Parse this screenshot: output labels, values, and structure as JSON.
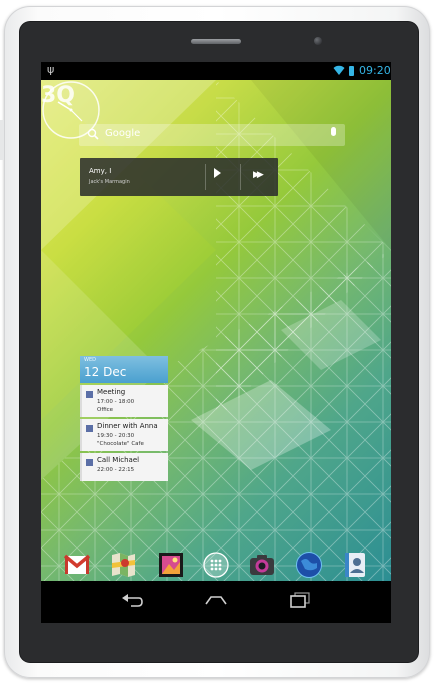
{
  "status_bar": {
    "time": "09:20",
    "icons": [
      "usb-icon",
      "wifi-icon",
      "battery-icon"
    ],
    "accent": "#35b5e5"
  },
  "search_widget": {
    "label": "Google",
    "icons": [
      "search-icon",
      "mic-icon"
    ]
  },
  "music_widget": {
    "artist": "Amy, I",
    "track": "Jack's Marmagin",
    "icons": [
      "play-icon",
      "next-icon"
    ]
  },
  "clock_widget": {
    "type": "analog"
  },
  "brand_logo": {
    "text": "3Q"
  },
  "calendar_widget": {
    "day": "WED",
    "date": "12 Dec",
    "events": [
      {
        "title": "Meeting",
        "time": "17:00 - 18:00",
        "location": "Office"
      },
      {
        "title": "Dinner with Anna",
        "time": "19:30 - 20:30",
        "location": "\"Chocolate\" Cafe"
      },
      {
        "title": "Call Michael",
        "time": "22:00 - 22:15",
        "location": ""
      }
    ],
    "accent": "#4aa0cf"
  },
  "dock": {
    "apps": [
      "gmail-icon",
      "maps-icon",
      "gallery-icon",
      "all-apps-icon",
      "camera-icon",
      "browser-icon",
      "contacts-icon"
    ]
  },
  "nav_bar": {
    "icons": [
      "back-icon",
      "home-icon",
      "recent-apps-icon"
    ]
  }
}
